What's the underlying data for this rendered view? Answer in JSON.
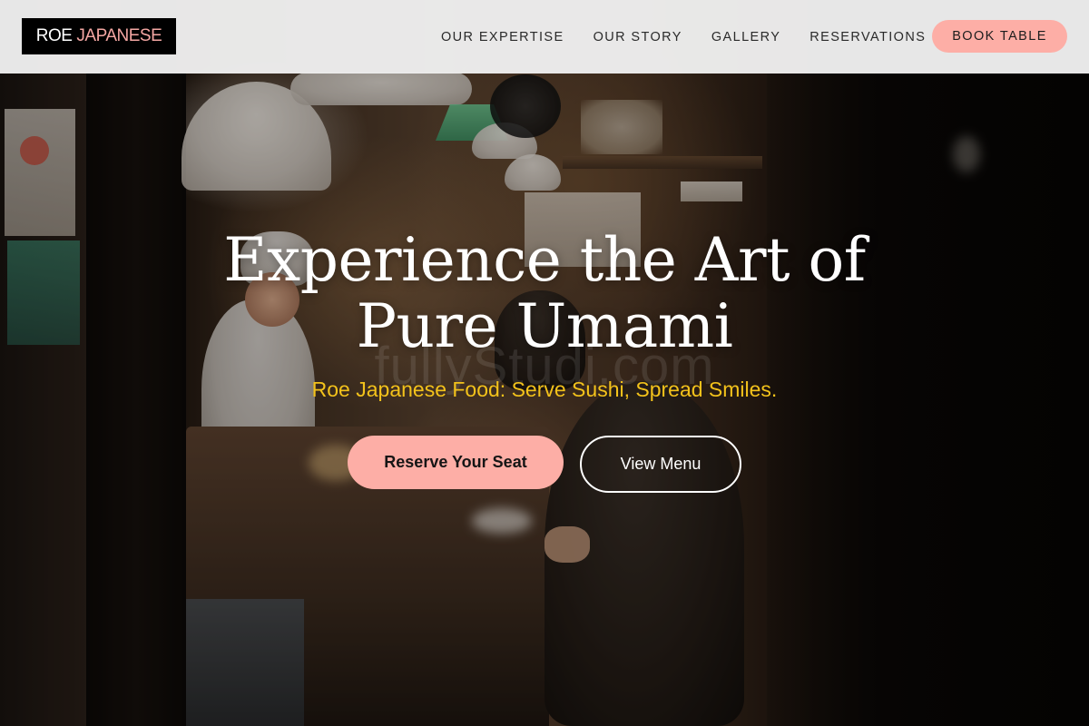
{
  "brand": {
    "part1": "ROE",
    "part2": "JAPANESE"
  },
  "nav": {
    "links": [
      {
        "label": "OUR EXPERTISE"
      },
      {
        "label": "OUR STORY"
      },
      {
        "label": "GALLERY"
      },
      {
        "label": "RESERVATIONS"
      }
    ],
    "book_label": "BOOK TABLE"
  },
  "hero": {
    "title_line1": "Experience the Art of",
    "title_line2": "Pure Umami",
    "watermark": "fullyStudi.com",
    "tagline": "Roe Japanese Food: Serve Sushi, Spread Smiles.",
    "primary_cta": "Reserve Your Seat",
    "secondary_cta": "View Menu"
  },
  "colors": {
    "accent_pink": "#fdaea6",
    "tagline_yellow": "#f3c21b",
    "logo_bg": "#000000",
    "navbar_bg": "#f0f0f0"
  },
  "icons": {
    "background": "restaurant-interior-photo"
  }
}
